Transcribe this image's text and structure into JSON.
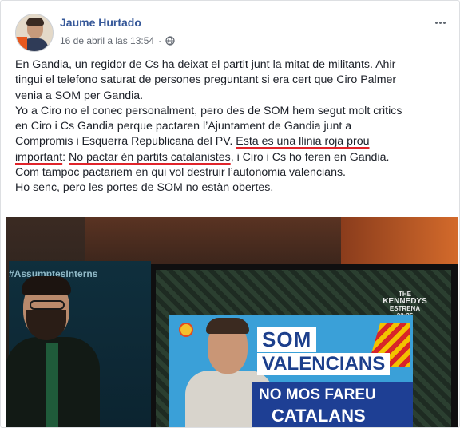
{
  "post": {
    "author": "Jaume Hurtado",
    "timestamp": "16 de abril a las 13:54",
    "privacy_icon": "globe-icon",
    "menu_icon": "more-options-icon",
    "lines": {
      "l1": "En Gandia, un regidor de Cs ha deixat el partit junt la mitat de militants. Ahir",
      "l2": "tingui el telefono saturat de persones preguntant si era cert que Ciro Palmer",
      "l3": "venia a SOM per Gandia.",
      "l4": "Yo a Ciro no el conec personalment, pero des de SOM hem segut molt critics",
      "l5": "en Ciro i Cs Gandia perque pactaren l’Ajuntament de Gandia junt a",
      "l6a": "Compromis i Esquerra Republicana del PV. ",
      "l6b": "Esta es una llinia roja prou",
      "l7a": "important",
      "l7b": ": ",
      "l7c": "No pactar én partits catalanistes",
      "l7d": ", i Ciro i Cs ho feren en Gandia.",
      "l8": "Com tampoc pactariem en qui vol destruir l’autonomia valencians.",
      "l9": "Ho senc, pero les portes de SOM no estàn obertes."
    },
    "highlight_color": "#e0242a"
  },
  "photo": {
    "hashtag": "#AssumptesInterns",
    "promo_line1": "THE",
    "promo_line2": "KENNEDYS",
    "promo_line3": "ESTRENA",
    "promo_line4": "22:35",
    "ad_line1": "SOM",
    "ad_line2": "VALENCIANS",
    "ad_line3": "NO MOS FAREU",
    "ad_line4": "CATALANS"
  }
}
